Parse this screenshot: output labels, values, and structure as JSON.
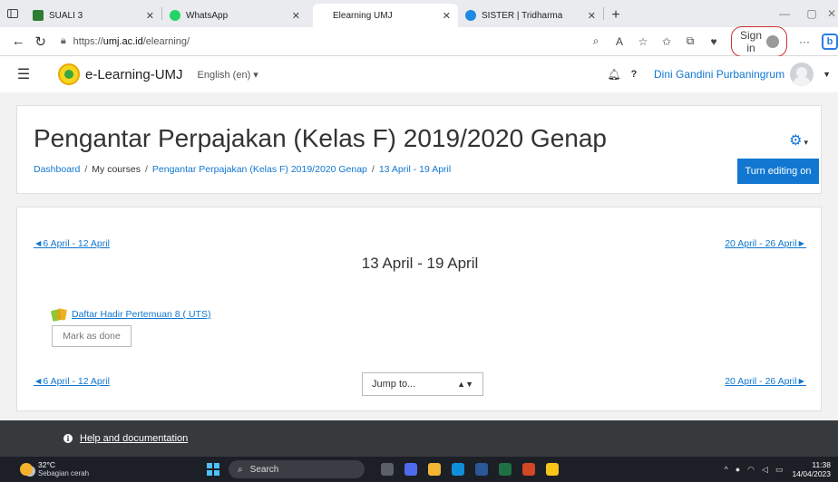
{
  "browser": {
    "tabs": [
      {
        "label": "SUALI 3",
        "color": "#2e7d32"
      },
      {
        "label": "WhatsApp",
        "color": "#25d366"
      },
      {
        "label": "Elearning UMJ",
        "color": "#ffffff"
      },
      {
        "label": "SISTER | Tridharma",
        "color": "#1e88e5"
      }
    ],
    "url_prefix": "https://",
    "url_host": "umj.ac.id",
    "url_path": "/elearning/",
    "sign_in": "Sign in"
  },
  "navbar": {
    "brand": "e-Learning-UMJ",
    "language": "English (en) ▾",
    "help": "?",
    "user": "Dini Gandini Purbaningrum"
  },
  "course": {
    "title": "Pengantar Perpajakan (Kelas F) 2019/2020 Genap",
    "breadcrumb": [
      "Dashboard",
      "My courses",
      "Pengantar Perpajakan (Kelas F) 2019/2020 Genap",
      "13 April - 19 April"
    ],
    "edit_button": "Turn editing on"
  },
  "week": {
    "prev": "◄6 April - 12 April",
    "next": "20 April - 26 April►",
    "title": "13 April - 19 April",
    "activity": "Daftar Hadir Pertemuan 8 ( UTS)",
    "mark_done": "Mark as done",
    "jump_to": "Jump to..."
  },
  "footer": {
    "help_link": "Help and documentation"
  },
  "taskbar": {
    "temperature": "32°C",
    "weather": "Sebagian cerah",
    "search": "Search",
    "time": "11:38",
    "date": "14/04/2023",
    "apps": [
      "#5b5f66",
      "#4f6bed",
      "#f2b632",
      "#0f8fdb",
      "#2b5797",
      "#1e7145",
      "#d24726",
      "#f5c518"
    ]
  }
}
